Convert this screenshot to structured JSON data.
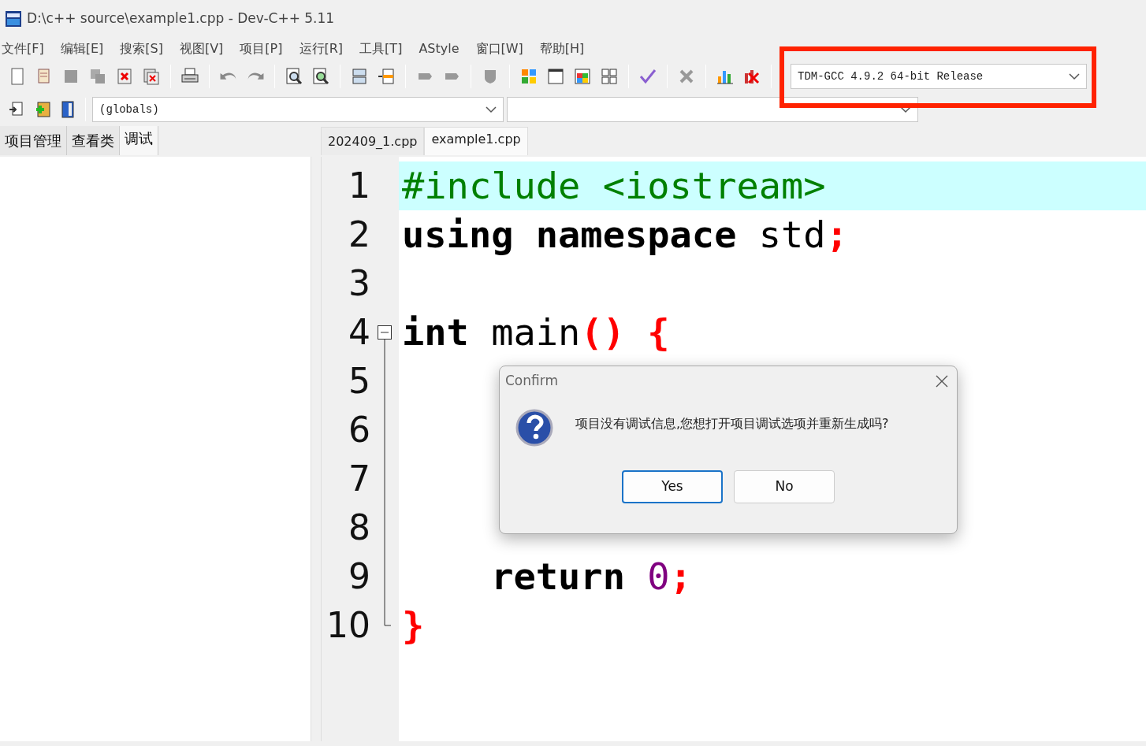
{
  "window": {
    "title": "D:\\c++ source\\example1.cpp - Dev-C++ 5.11"
  },
  "menu": [
    "文件[F]",
    "编辑[E]",
    "搜索[S]",
    "视图[V]",
    "项目[P]",
    "运行[R]",
    "工具[T]",
    "AStyle",
    "窗口[W]",
    "帮助[H]"
  ],
  "compiler_select": {
    "value": "TDM-GCC 4.9.2 64-bit Release"
  },
  "scope_select": {
    "value": "(globals)"
  },
  "side_tabs": [
    {
      "label": "项目管理",
      "selected": false
    },
    {
      "label": "查看类",
      "selected": false
    },
    {
      "label": "调试",
      "selected": true
    }
  ],
  "file_tabs": [
    {
      "label": "202409_1.cpp",
      "selected": false
    },
    {
      "label": "example1.cpp",
      "selected": true
    }
  ],
  "editor": {
    "lines": [
      {
        "number": "1",
        "highlighted": true,
        "tokens": [
          {
            "text": "#include <iostream>",
            "kind": "preproc"
          }
        ]
      },
      {
        "number": "2",
        "highlighted": false,
        "tokens": [
          {
            "text": "using namespace",
            "kind": "keyword"
          },
          {
            "text": " std",
            "kind": "plain"
          },
          {
            "text": ";",
            "kind": "symbol"
          }
        ]
      },
      {
        "number": "3",
        "highlighted": false
      },
      {
        "number": "4",
        "highlighted": false,
        "fold_start": true,
        "tokens": [
          {
            "text": "int",
            "kind": "keyword"
          },
          {
            "text": " main",
            "kind": "plain"
          },
          {
            "text": "()",
            "kind": "symbol"
          },
          {
            "text": " {",
            "kind": "symbol"
          }
        ]
      },
      {
        "number": "5",
        "highlighted": false
      },
      {
        "number": "6",
        "highlighted": false
      },
      {
        "number": "7",
        "highlighted": false
      },
      {
        "number": "8",
        "highlighted": false
      },
      {
        "number": "9",
        "highlighted": false,
        "tokens": [
          {
            "text": "    return",
            "kind": "keyword"
          },
          {
            "text": " 0",
            "kind": "number"
          },
          {
            "text": ";",
            "kind": "symbol"
          }
        ]
      },
      {
        "number": "10",
        "highlighted": false,
        "fold_end": true,
        "tokens": [
          {
            "text": "}",
            "kind": "symbol"
          }
        ]
      }
    ]
  },
  "dialog": {
    "title": "Confirm",
    "message": "项目没有调试信息,您想打开项目调试选项并重新生成吗?",
    "buttons": [
      {
        "label": "Yes",
        "default": true
      },
      {
        "label": "No",
        "default": false
      }
    ]
  }
}
